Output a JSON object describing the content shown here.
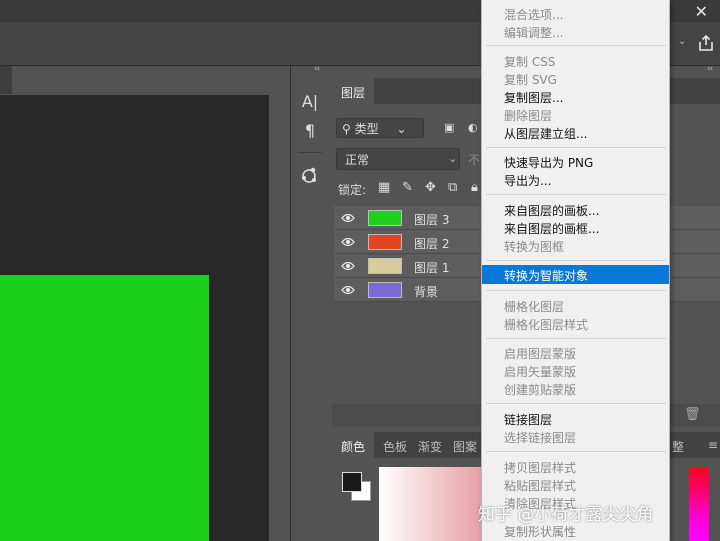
{
  "window": {
    "close_glyph": "✕"
  },
  "panels": {
    "collapse_glyph": "‹‹"
  },
  "layers_panel": {
    "tab": "图层",
    "filter": "类型",
    "blend_mode": "正常",
    "opacity_label": "不",
    "lock_label": "锁定:",
    "layers": [
      {
        "name": "图层 3",
        "color": "#1fd11f"
      },
      {
        "name": "图层 2",
        "color": "#e0461f"
      },
      {
        "name": "图层 1",
        "color": "#d7cc9a"
      },
      {
        "name": "背景",
        "color": "#7b69d4"
      }
    ]
  },
  "color_panel": {
    "tabs": [
      "颜色",
      "色板",
      "渐变",
      "图案"
    ],
    "partial_tab": "整"
  },
  "context_menu": {
    "items": [
      {
        "label": "混合选项...",
        "disabled": true
      },
      {
        "label": "编辑调整...",
        "disabled": true
      },
      {
        "label": "复制 CSS",
        "disabled": true
      },
      {
        "label": "复制 SVG",
        "disabled": true
      },
      {
        "label": "复制图层...",
        "disabled": false
      },
      {
        "label": "删除图层",
        "disabled": true
      },
      {
        "label": "从图层建立组...",
        "disabled": false
      },
      {
        "label": "快速导出为 PNG",
        "disabled": false
      },
      {
        "label": "导出为...",
        "disabled": false
      },
      {
        "label": "来自图层的画板...",
        "disabled": false
      },
      {
        "label": "来自图层的画框...",
        "disabled": false
      },
      {
        "label": "转换为图框",
        "disabled": true
      },
      {
        "label": "转换为智能对象",
        "disabled": false,
        "highlighted": true
      },
      {
        "label": "栅格化图层",
        "disabled": true
      },
      {
        "label": "栅格化图层样式",
        "disabled": true
      },
      {
        "label": "启用图层蒙版",
        "disabled": true
      },
      {
        "label": "启用矢量蒙版",
        "disabled": true
      },
      {
        "label": "创建剪贴蒙版",
        "disabled": true
      },
      {
        "label": "链接图层",
        "disabled": false
      },
      {
        "label": "选择链接图层",
        "disabled": true
      },
      {
        "label": "拷贝图层样式",
        "disabled": true
      },
      {
        "label": "粘贴图层样式",
        "disabled": true
      },
      {
        "label": "清除图层样式",
        "disabled": true
      },
      {
        "label": "复制形状属性",
        "disabled": true
      }
    ]
  },
  "watermark": "知乎 @小荷才露尖尖角",
  "colors": {
    "canvas_layer": "#1bd11b",
    "menu_highlight": "#0a78d7"
  }
}
